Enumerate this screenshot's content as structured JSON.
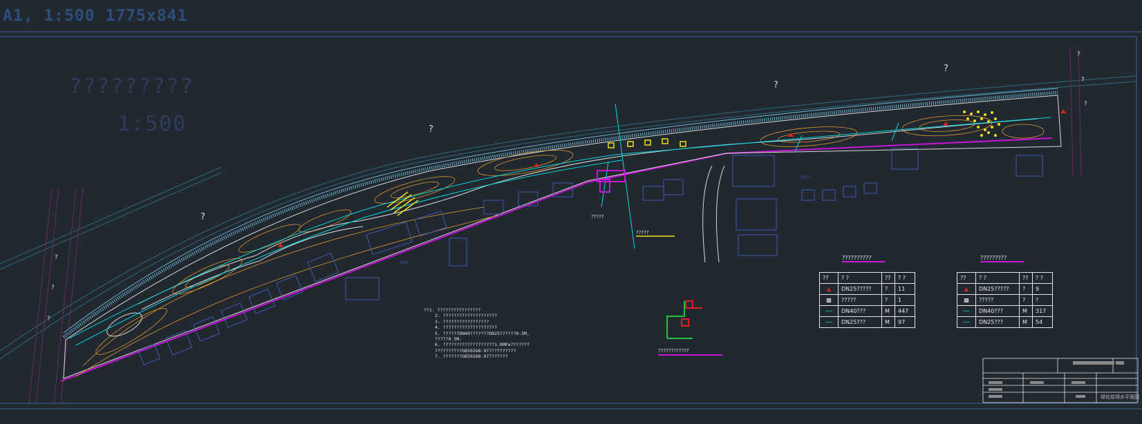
{
  "header": {
    "sheet_info": "A1, 1:500  1775x841"
  },
  "drawing": {
    "title": "?????????",
    "scale": "1:500",
    "qmarks": [
      "?",
      "?",
      "?",
      "?",
      "?",
      "?",
      "?",
      "?",
      "?",
      "?"
    ],
    "label_center": "?????",
    "label_junction": "?????",
    "label_detail": "????????????",
    "label_west": "????",
    "label_east": "????"
  },
  "notes": {
    "lines": [
      "??1. ????????????????",
      "2. ????????????????????",
      "3. ?????????????????",
      "4. ????????????????????",
      "5. ??????DN40???????DN25??????0.5M,",
      "    ?????0.5M.",
      "6. ???????????????????1.0MPa???????",
      "    ??????????GB50268-97??????????",
      "7. ???????GB50268-97???????"
    ]
  },
  "legend_tables": [
    {
      "title": "??????????",
      "header": [
        "??",
        "?  ?",
        "??",
        "? ?"
      ],
      "rows": [
        [
          "DN25?????",
          "?",
          "11"
        ],
        [
          "?????",
          "?",
          "1"
        ],
        [
          "DN40???",
          "M",
          "447"
        ],
        [
          "DN25???",
          "M",
          "97"
        ]
      ]
    },
    {
      "title": "?????????",
      "header": [
        "??",
        "?  ?",
        "??",
        "? ?"
      ],
      "rows": [
        [
          "DN25?????",
          "?",
          "9"
        ],
        [
          "?????",
          "?",
          "?"
        ],
        [
          "DN40???",
          "M",
          "317"
        ],
        [
          "DN25???",
          "M",
          "54"
        ]
      ]
    }
  ],
  "title_block": {
    "drawing_name": "绿化给排水平面图"
  },
  "colors": {
    "background": "#212830",
    "frame": "#3a64a8",
    "pipe_main": "#00d8e0",
    "contour": "#e39a2a",
    "property_line": "#c814d8",
    "buildings": "#4466cc",
    "white": "#e6e6e6",
    "yellow": "#f0e020"
  }
}
